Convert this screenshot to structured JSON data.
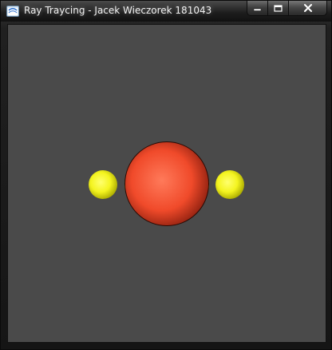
{
  "window": {
    "title": "Ray Traycing - Jacek Wieczorek 181043",
    "icon": "window-app-icon",
    "buttons": {
      "minimize": "minimize-icon",
      "maximize": "maximize-icon",
      "close": "close-icon"
    }
  },
  "scene": {
    "background_color": "#4a4a4a",
    "spheres": [
      {
        "name": "left-yellow-sphere",
        "color": "#f4f41f",
        "highlight": "#ffff6e",
        "shade": "#a8a800"
      },
      {
        "name": "center-red-sphere",
        "color": "#f04a2a",
        "highlight": "#ff7a5a",
        "shade": "#8a1e0e"
      },
      {
        "name": "right-yellow-sphere",
        "color": "#f4f41f",
        "highlight": "#ffff6e",
        "shade": "#a8a800"
      }
    ]
  }
}
